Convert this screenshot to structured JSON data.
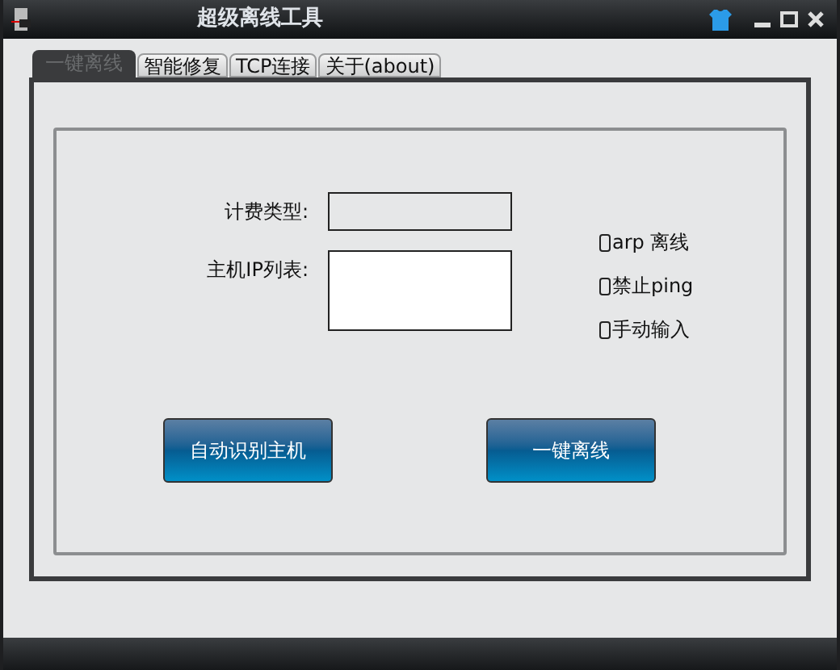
{
  "window": {
    "title": "超级离线工具"
  },
  "tabs": [
    {
      "label": "一键离线",
      "selected": true
    },
    {
      "label": "智能修复",
      "selected": false
    },
    {
      "label": "TCP连接",
      "selected": false
    },
    {
      "label": "关于(about)",
      "selected": false
    }
  ],
  "fields": [
    {
      "label": "计费类型:",
      "kind": "line"
    },
    {
      "label": "主机IP列表:",
      "kind": "area"
    }
  ],
  "options": [
    {
      "label": "arp 离线",
      "checked": false
    },
    {
      "label": "禁止ping",
      "checked": false
    },
    {
      "label": "手动输入",
      "checked": false
    }
  ],
  "buttons": [
    "自动识别主机",
    "一键离线"
  ]
}
